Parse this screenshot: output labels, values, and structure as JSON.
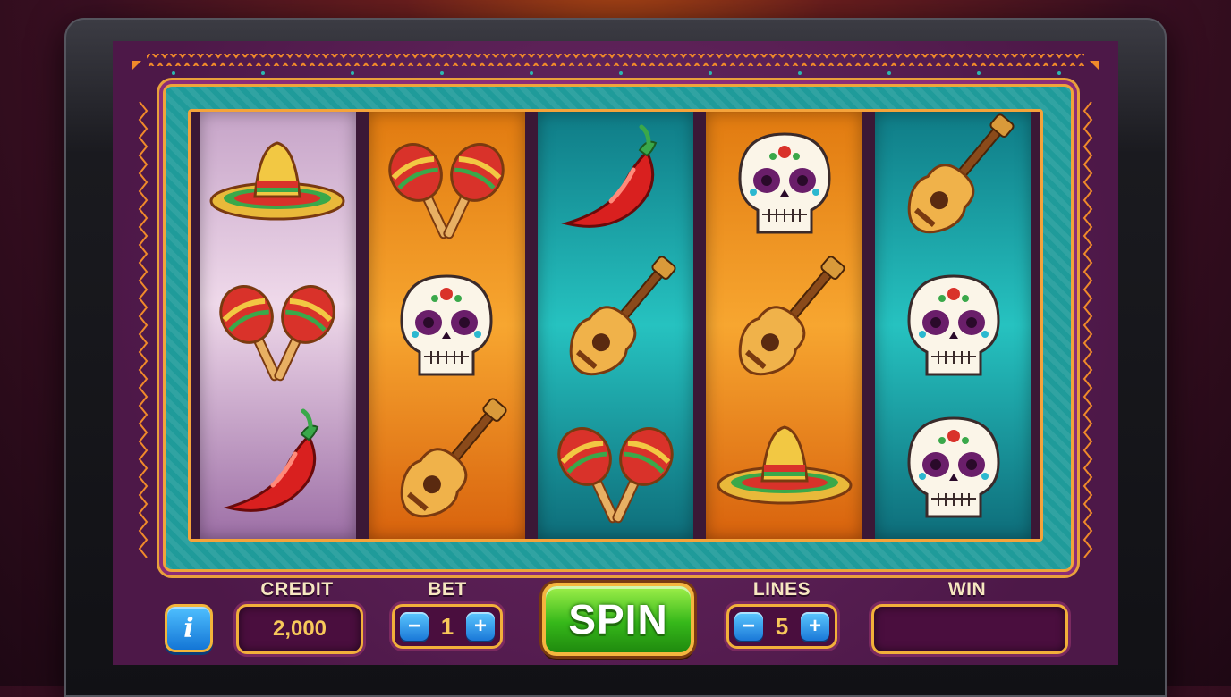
{
  "game": {
    "reels": [
      {
        "theme": "lilac",
        "symbols": [
          "sombrero-icon",
          "maracas-icon",
          "chili-pepper-icon"
        ]
      },
      {
        "theme": "orange",
        "symbols": [
          "maracas-icon",
          "sugar-skull-icon",
          "guitar-icon"
        ]
      },
      {
        "theme": "teal",
        "symbols": [
          "chili-pepper-icon",
          "guitar-icon",
          "maracas-icon"
        ]
      },
      {
        "theme": "orange",
        "symbols": [
          "sugar-skull-icon",
          "guitar-icon",
          "sombrero-icon"
        ]
      },
      {
        "theme": "teal",
        "symbols": [
          "guitar-icon",
          "sugar-skull-icon",
          "sugar-skull-icon"
        ]
      }
    ]
  },
  "controls": {
    "info_icon": "i",
    "credit": {
      "label": "CREDIT",
      "value": "2,000"
    },
    "bet": {
      "label": "BET",
      "value": "1",
      "minus": "−",
      "plus": "+"
    },
    "spin_label": "SPIN",
    "lines": {
      "label": "LINES",
      "value": "5",
      "minus": "−",
      "plus": "+"
    },
    "win": {
      "label": "WIN",
      "value": ""
    }
  },
  "colors": {
    "background": "#5a1f55",
    "frame_teal": "#1f9b9a",
    "accent_gold": "#f2b03a",
    "spin_green": "#36b81a"
  }
}
